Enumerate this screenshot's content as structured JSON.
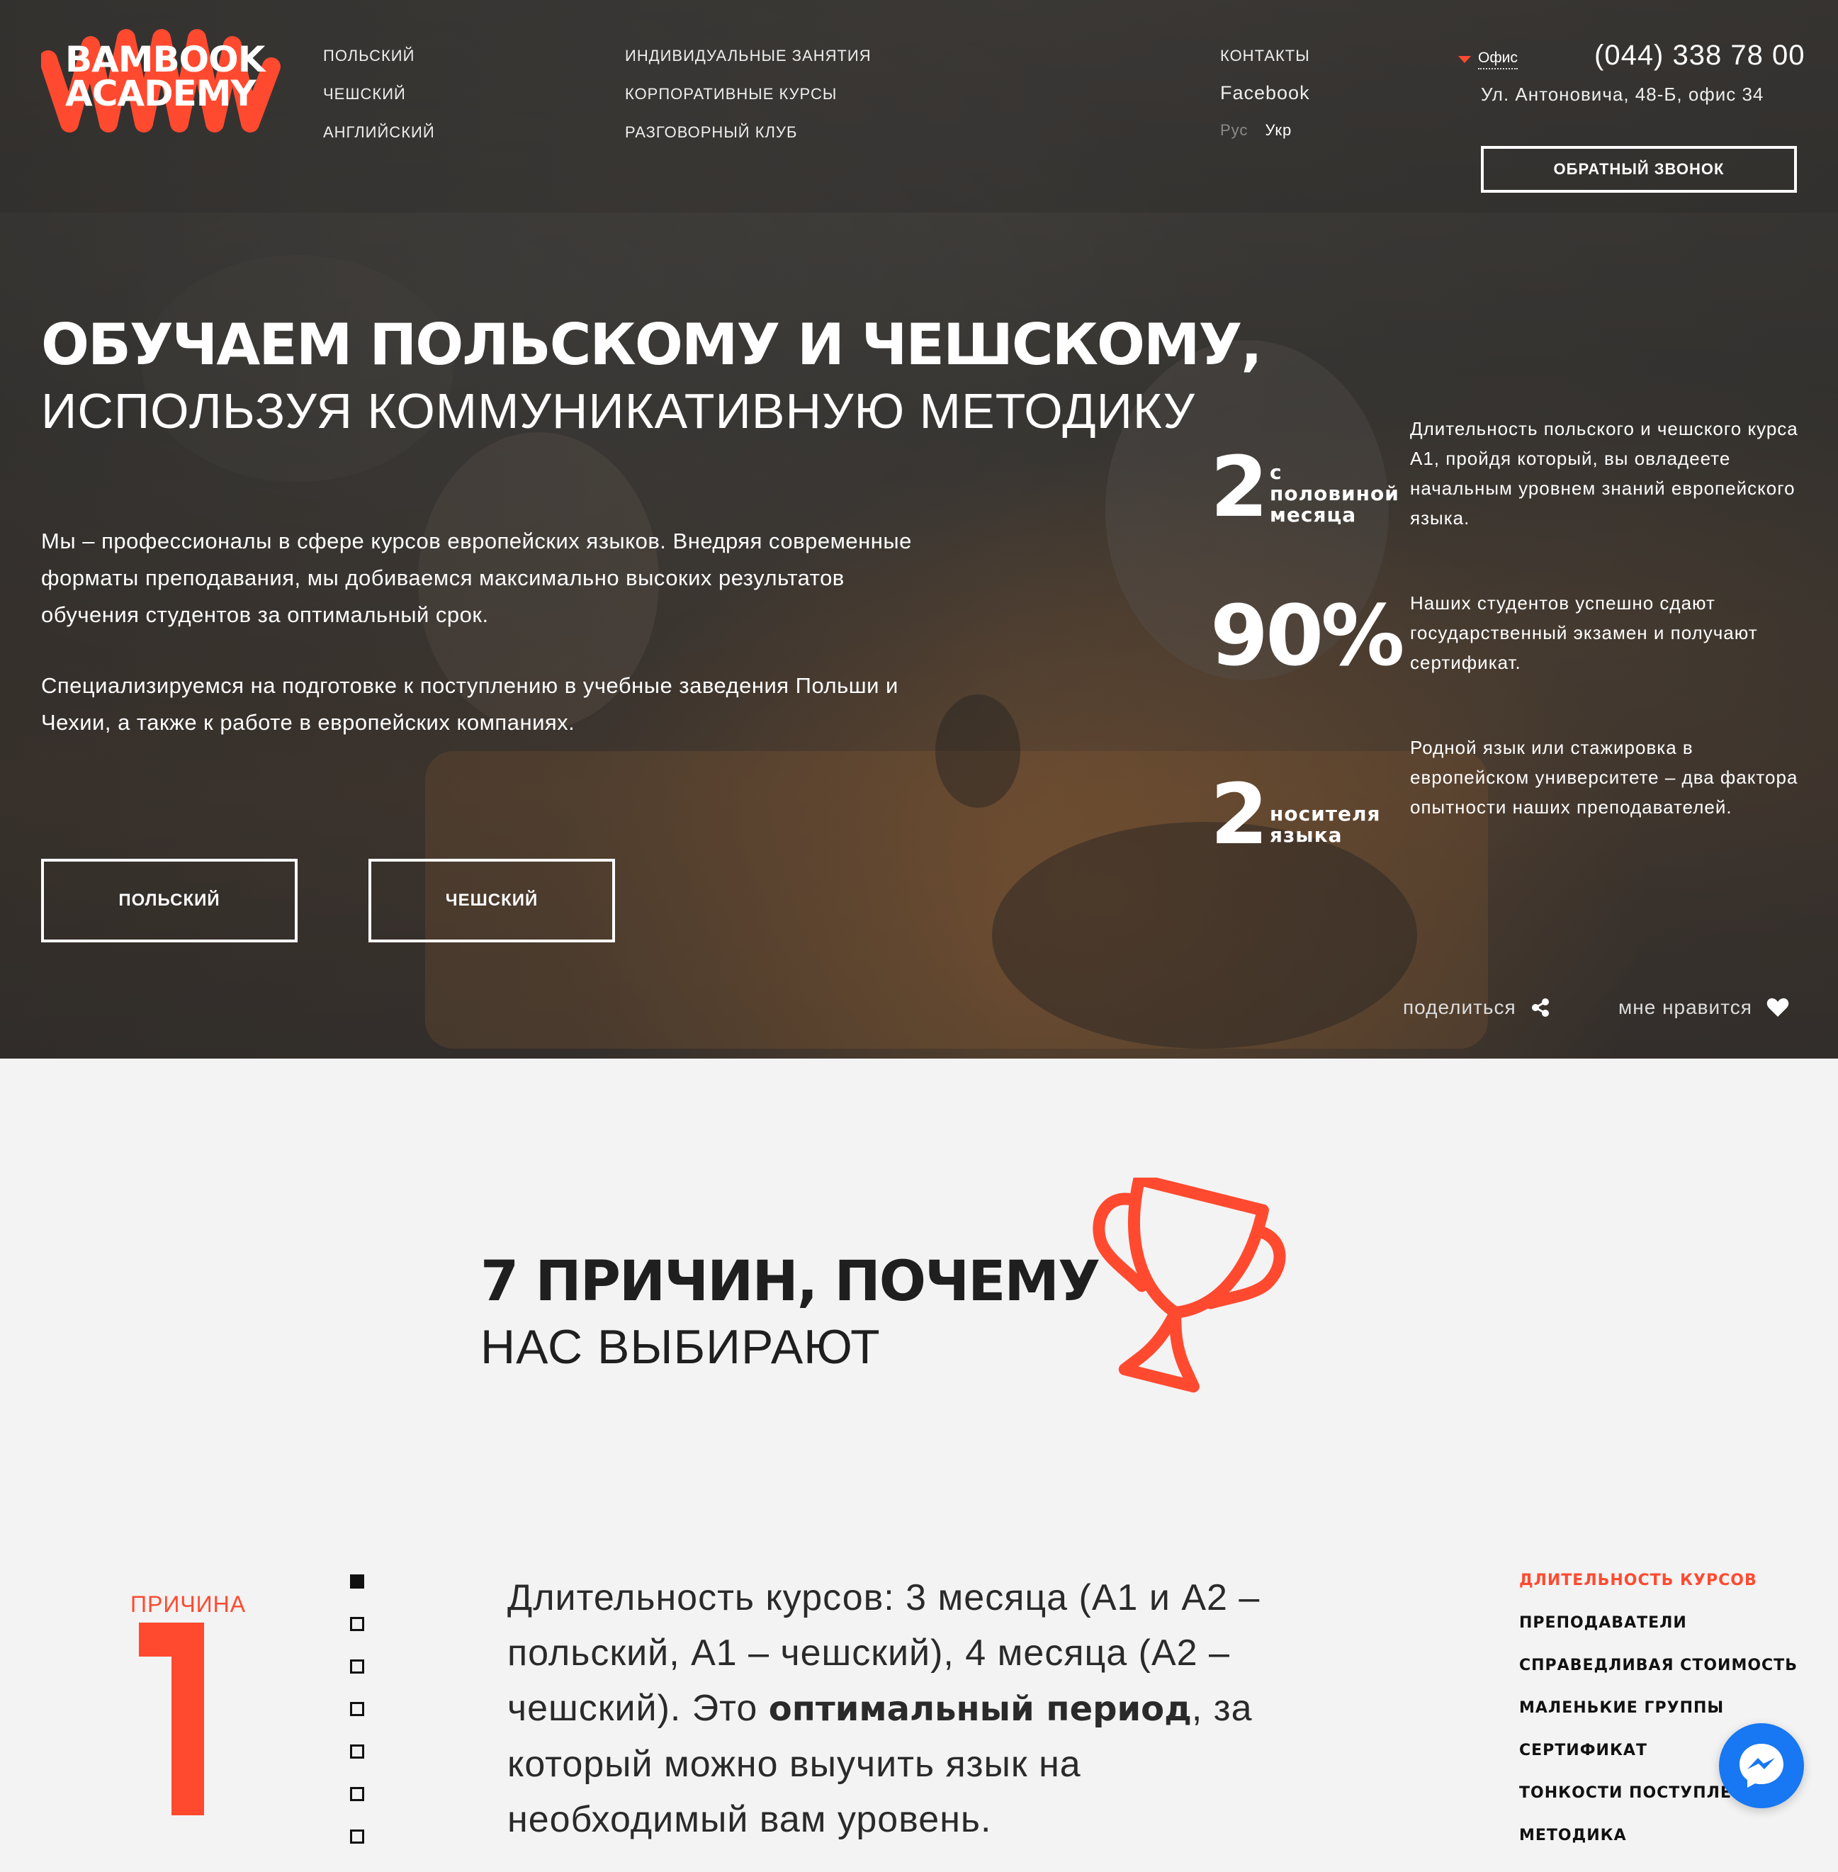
{
  "brand": {
    "logo_line1": "BAMBOOK",
    "logo_line2": "ACADEMY",
    "accent_color": "#ff4a30"
  },
  "nav": {
    "col1": [
      "ПОЛЬСКИЙ",
      "ЧЕШСКИЙ",
      "АНГЛИЙСКИЙ"
    ],
    "col2": [
      "ИНДИВИДУАЛЬНЫЕ ЗАНЯТИЯ",
      "КОРПОРАТИВНЫЕ КУРСЫ",
      "РАЗГОВОРНЫЙ КЛУБ"
    ],
    "contacts": "КОНТАКТЫ",
    "facebook": "Facebook",
    "lang_ru": "Рус",
    "lang_uk": "Укр"
  },
  "contact": {
    "office_label": "Офис",
    "phone": "(044) 338 78 00",
    "address": "Ул. Антоновича, 48-Б, офис 34",
    "callback_label": "ОБРАТНЫЙ ЗВОНОК"
  },
  "hero": {
    "title_bold": "ОБУЧАЕМ ПОЛЬСКОМУ И ЧЕШСКОМУ,",
    "title_light": "ИСПОЛЬЗУЯ КОММУНИКАТИВНУЮ МЕТОДИКУ",
    "paragraph1": "Мы – профессионалы в сфере курсов европейских языков. Внедряя современные форматы преподавания, мы добиваемся максимально высоких результатов обучения студентов за оптимальный срок.",
    "paragraph2": "Специализируемся на подготовке к поступлению в учебные заведения Польши и Чехии, а также к работе в европейских компаниях.",
    "btn_polish": "ПОЛЬСКИЙ",
    "btn_czech": "ЧЕШСКИЙ",
    "share_label": "поделиться",
    "like_label": "мне нравится",
    "share_icon": "share-icon",
    "like_icon": "heart-icon"
  },
  "stats": [
    {
      "number": "2",
      "unit_line1": "с",
      "unit_line2": "половиной",
      "unit_line3": "месяца",
      "desc": "Длительность польского и чешского курса A1, пройдя который, вы овладеете начальным уровнем знаний европейского языка."
    },
    {
      "number": "90%",
      "desc": "Наших студентов успешно сдают государственный экзамен и получают сертификат."
    },
    {
      "number": "2",
      "unit_line1": "носителя",
      "unit_line2": "языка",
      "desc": "Родной язык или стажировка в европейском университете – два фактора опытности наших преподавателей."
    }
  ],
  "reasons": {
    "title_bold": "7 ПРИЧИН, ПОЧЕМУ",
    "title_light": "НАС ВЫБИРАЮТ",
    "trophy_icon": "trophy-icon",
    "reason_label": "ПРИЧИНА",
    "reason_number": "1",
    "text_before": "Длительность курсов: 3 месяца (A1 и A2 – польский, A1 – чешский), 4 месяца (A2 – чешский). Это ",
    "text_bold": "оптимальный период",
    "text_after": ", за который можно выучить язык на необходимый вам уровень.",
    "active_index": 0,
    "list": [
      "ДЛИТЕЛЬНОСТЬ КУРСОВ",
      "ПРЕПОДАВАТЕЛИ",
      "СПРАВЕДЛИВАЯ СТОИМОСТЬ",
      "МАЛЕНЬКИЕ ГРУППЫ",
      "СЕРТИФИКАТ",
      "ТОНКОСТИ ПОСТУПЛЕНИЯ",
      "МЕТОДИКА"
    ]
  },
  "messenger_icon": "messenger-icon"
}
